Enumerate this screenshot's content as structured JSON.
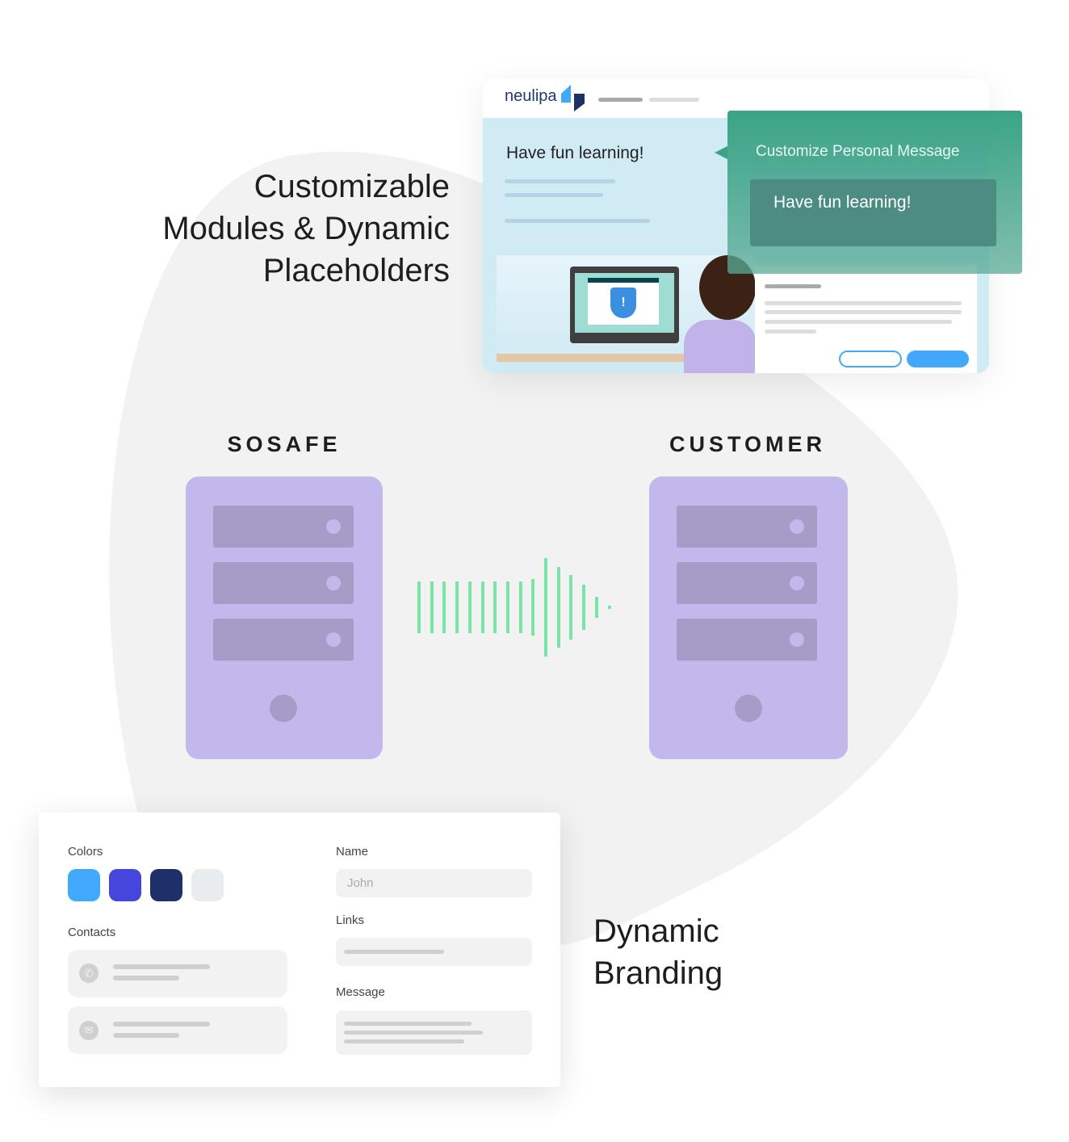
{
  "headings": {
    "modules": [
      "Customizable",
      "Modules & Dynamic",
      "Placeholders"
    ],
    "branding": [
      "Dynamic",
      "Branding"
    ]
  },
  "servers": {
    "left": "SOSAFE",
    "right": "CUSTOMER"
  },
  "preview": {
    "logo": "neulipa",
    "greeting": "Have fun learning!",
    "popup_title": "Customize Personal Message",
    "popup_value": "Have fun learning!"
  },
  "branding_form": {
    "colors_label": "Colors",
    "colors": [
      "#42a8fb",
      "#4646dc",
      "#1d3068",
      "#e8ecef"
    ],
    "contacts_label": "Contacts",
    "contacts": [
      {
        "icon": "phone-icon"
      },
      {
        "icon": "mail-icon"
      }
    ],
    "name_label": "Name",
    "name_placeholder": "John",
    "links_label": "Links",
    "message_label": "Message"
  }
}
